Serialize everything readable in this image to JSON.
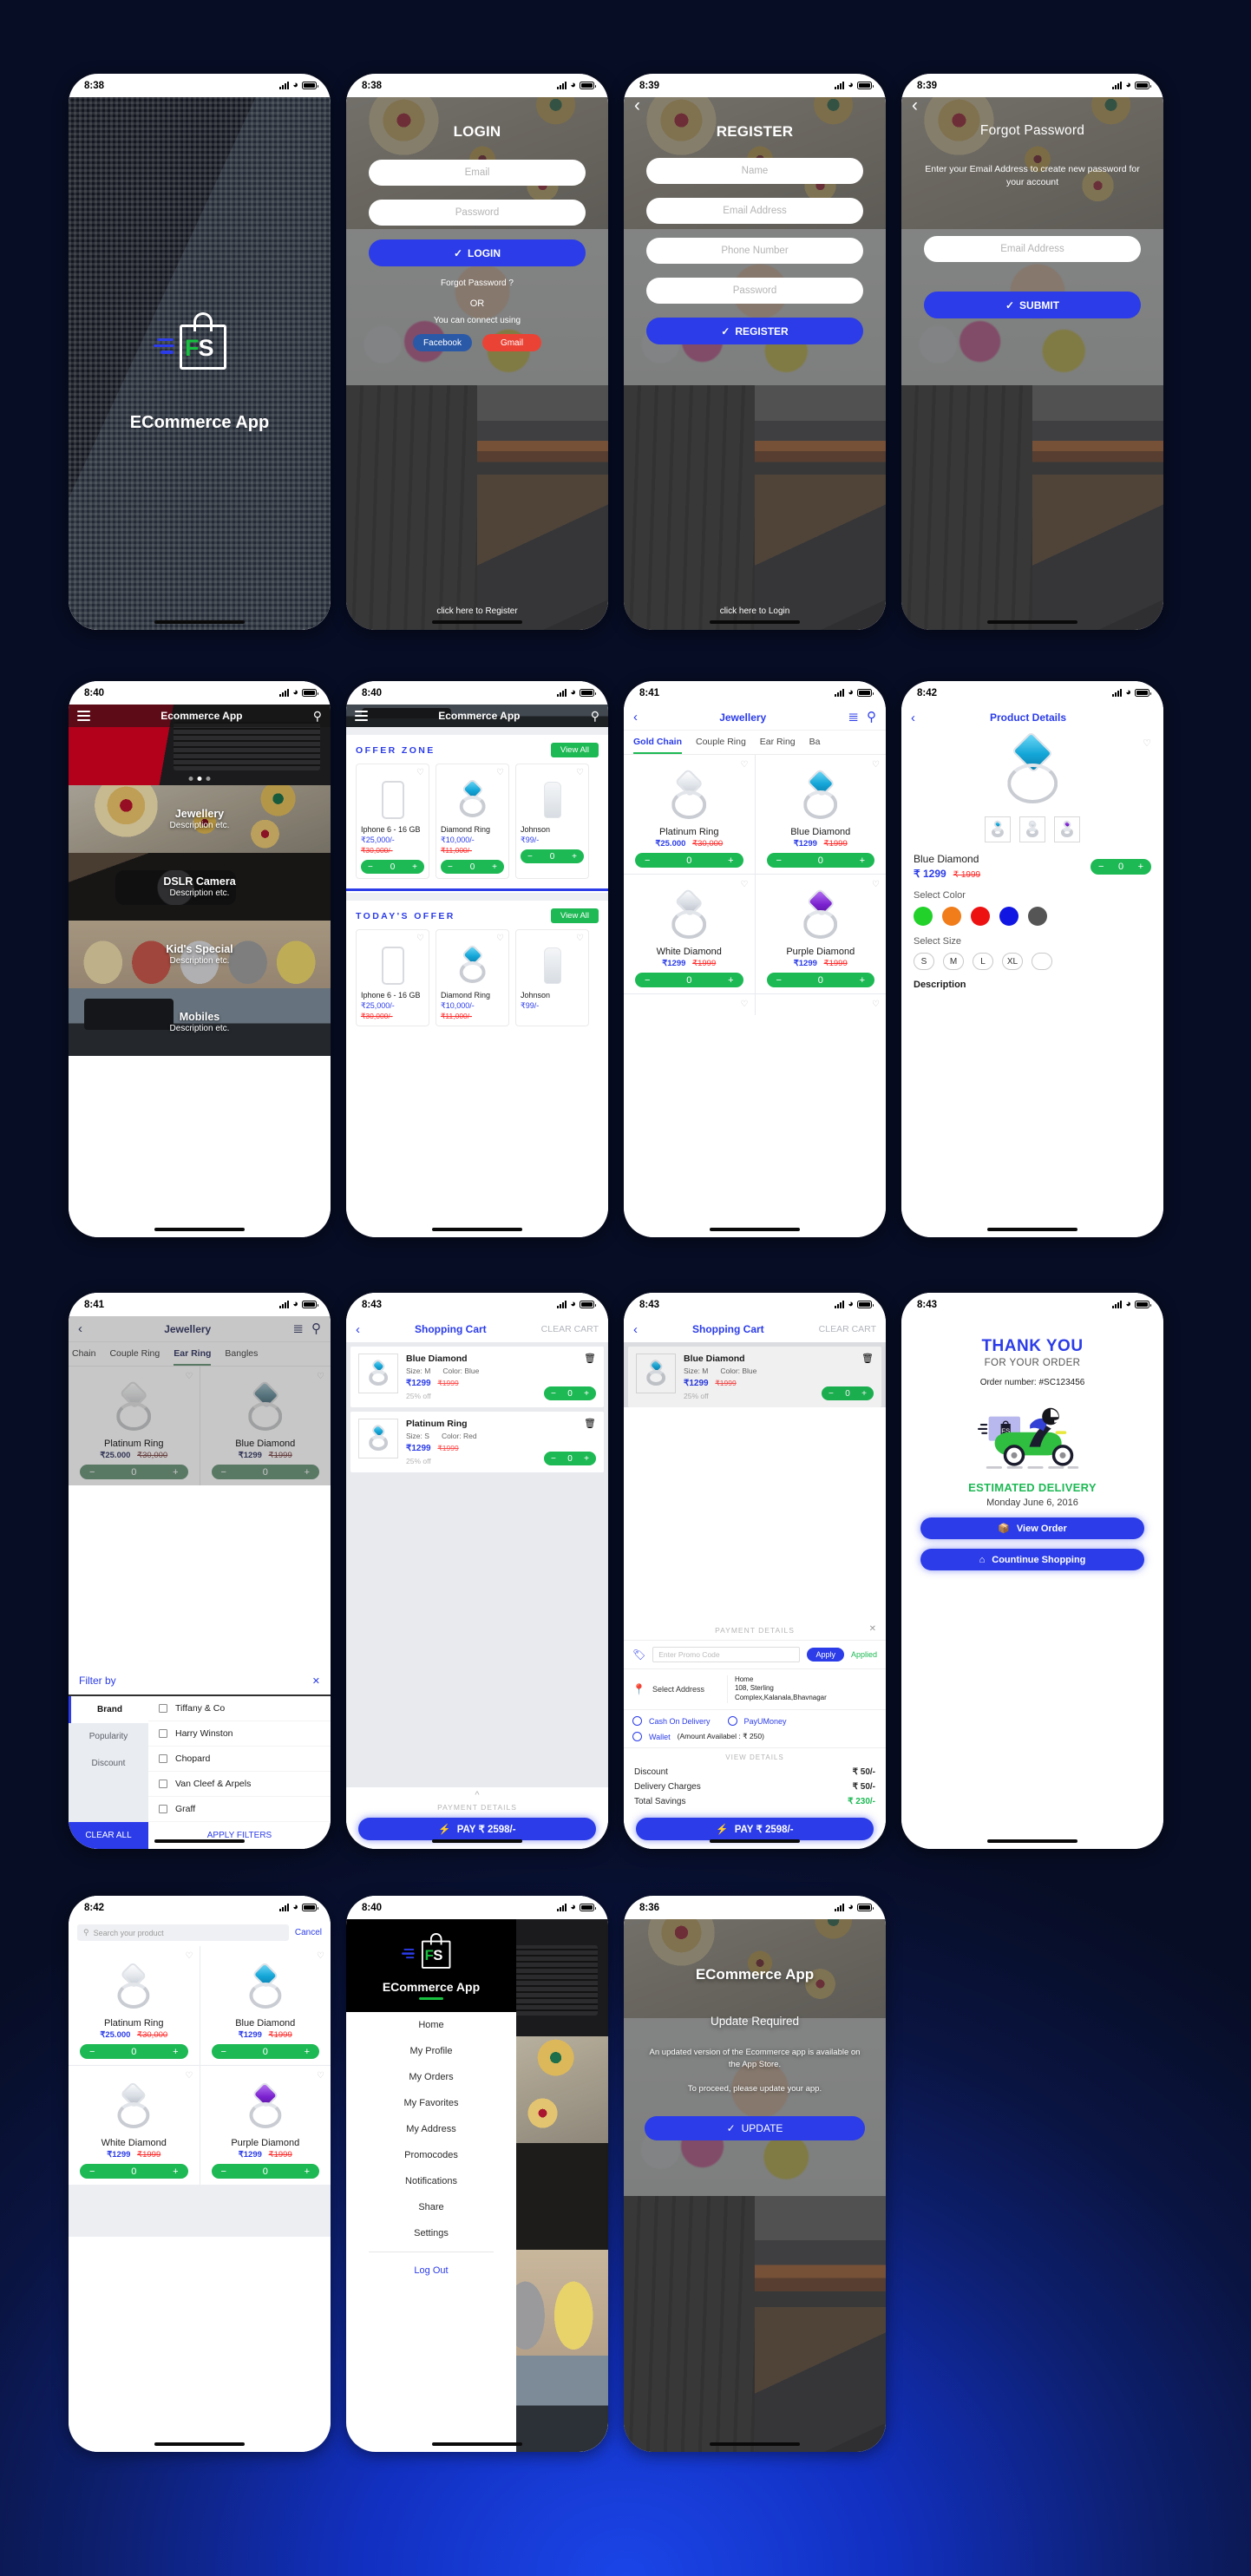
{
  "app": {
    "name": "ECommerce App",
    "brand_short": "FS"
  },
  "colors": {
    "primary": "#2b3ce8",
    "green": "#1db954",
    "red": "#ff2b2b",
    "facebook": "#2a59a8",
    "gmail": "#ea4335",
    "dark": "#000000"
  },
  "screens": {
    "splash": {
      "time": "8:38",
      "app_name": "ECommerce App"
    },
    "login": {
      "time": "8:38",
      "title": "LOGIN",
      "email_placeholder": "Email",
      "password_placeholder": "Password",
      "login_button": "LOGIN",
      "forgot": "Forgot Password ?",
      "or": "OR",
      "connect_using": "You can connect using",
      "facebook": "Facebook",
      "gmail": "Gmail",
      "register_link": "click here to Register"
    },
    "register": {
      "time": "8:39",
      "title": "REGISTER",
      "name_placeholder": "Name",
      "email_placeholder": "Email Address",
      "phone_placeholder": "Phone Number",
      "password_placeholder": "Password",
      "register_button": "REGISTER",
      "login_link": "click here to Login"
    },
    "forgot": {
      "time": "8:39",
      "title": "Forgot Password",
      "instruction": "Enter your Email Address to create new password for your account",
      "email_placeholder": "Email Address",
      "submit_button": "SUBMIT"
    },
    "home": {
      "time": "8:40",
      "appbar_title": "Ecommerce App",
      "categories": [
        {
          "name": "Jewellery",
          "desc": "Description etc."
        },
        {
          "name": "DSLR Camera",
          "desc": "Description etc."
        },
        {
          "name": "Kid's Special",
          "desc": "Description etc."
        },
        {
          "name": "Mobiles",
          "desc": "Description etc."
        }
      ]
    },
    "offers": {
      "time": "8:40",
      "appbar_title": "Ecommerce App",
      "sections": [
        {
          "title": "OFFER ZONE",
          "view_all": "View All",
          "products": [
            {
              "name": "Iphone 6 - 16 GB",
              "price": "₹25,000/-",
              "old": "₹30,000/-",
              "qty": "0",
              "art": "phone"
            },
            {
              "name": "Diamond Ring",
              "price": "₹10,000/-",
              "old": "₹11,000/-",
              "qty": "0",
              "art": "ring-blue"
            },
            {
              "name": "Johnson",
              "price": "₹99/-",
              "old": "",
              "qty": "0",
              "art": "bottle"
            }
          ]
        },
        {
          "title": "TODAY'S OFFER",
          "view_all": "View All",
          "products": [
            {
              "name": "Iphone 6 - 16 GB",
              "price": "₹25,000/-",
              "old": "₹30,000/-",
              "qty": "0",
              "art": "phone"
            },
            {
              "name": "Diamond Ring",
              "price": "₹10,000/-",
              "old": "₹11,000/-",
              "qty": "0",
              "art": "ring-blue"
            },
            {
              "name": "Johnson",
              "price": "₹99/-",
              "old": "",
              "qty": "0",
              "art": "bottle"
            }
          ]
        }
      ]
    },
    "listing": {
      "time": "8:41",
      "title": "Jewellery",
      "tabs": [
        "Gold Chain",
        "Couple Ring",
        "Ear Ring",
        "Ba"
      ],
      "active_tab": "Gold Chain",
      "products": [
        {
          "name": "Platinum Ring",
          "price": "₹25.000",
          "old": "₹30,000",
          "qty": "0",
          "art": "ring-clear"
        },
        {
          "name": "Blue Diamond",
          "price": "₹1299",
          "old": "₹1999",
          "qty": "0",
          "art": "ring-blue"
        },
        {
          "name": "White Diamond",
          "price": "₹1299",
          "old": "₹1999",
          "qty": "0",
          "art": "ring-white"
        },
        {
          "name": "Purple Diamond",
          "price": "₹1299",
          "old": "₹1999",
          "qty": "0",
          "art": "ring-purple"
        }
      ]
    },
    "details": {
      "time": "8:42",
      "title": "Product Details",
      "product_name": "Blue Diamond",
      "price": "₹ 1299",
      "old_price": "₹ 1999",
      "qty": "0",
      "select_color_label": "Select Color",
      "colors": [
        "#22d12a",
        "#f07c1a",
        "#ee1111",
        "#1116e2",
        "#555555"
      ],
      "select_size_label": "Select Size",
      "sizes": [
        "S",
        "M",
        "L",
        "XL"
      ],
      "description_label": "Description"
    },
    "filter": {
      "time": "8:41",
      "title": "Jewellery",
      "tabs": [
        "Chain",
        "Couple Ring",
        "Ear Ring",
        "Bangles"
      ],
      "active_tab": "Ear Ring",
      "products": [
        {
          "name": "Platinum Ring",
          "price": "₹25.000",
          "old": "₹30,000",
          "art": "ring-clear"
        },
        {
          "name": "Blue Diamond",
          "price": "₹1299",
          "old": "₹1999",
          "art": "ring-blue"
        }
      ],
      "sheet_title": "Filter by",
      "groups": [
        "Brand",
        "Popularity",
        "Discount"
      ],
      "active_group": "Brand",
      "brands": [
        "Tiffany & Co",
        "Harry Winston",
        "Chopard",
        "Van Cleef & Arpels",
        "Graff"
      ],
      "clear_all": "CLEAR ALL",
      "apply": "APPLY FILTERS"
    },
    "cart": {
      "time": "8:43",
      "title": "Shopping Cart",
      "clear_cart": "CLEAR CART",
      "items": [
        {
          "name": "Blue Diamond",
          "size": "Size: M",
          "color": "Color: Blue",
          "price": "₹1299",
          "old": "₹1999",
          "off": "25% off",
          "qty": "0"
        },
        {
          "name": "Platinum Ring",
          "size": "Size: S",
          "color": "Color: Red",
          "price": "₹1299",
          "old": "₹1999",
          "off": "25% off",
          "qty": "0"
        }
      ],
      "payment_details_label": "PAYMENT DETAILS",
      "pay_button": "PAY ₹ 2598/-"
    },
    "payment": {
      "time": "8:43",
      "title": "Shopping Cart",
      "clear_cart": "CLEAR CART",
      "sheet_title": "PAYMENT DETAILS",
      "promo_placeholder": "Enter Promo Code",
      "apply": "Apply",
      "applied": "Applied",
      "select_address_label": "Select Address",
      "address": "Home\n108, Sterling\nComplex,Kalanala,Bhavnagar",
      "address_lines": [
        "Home",
        "108, Sterling",
        "Complex,Kalanala,Bhavnagar"
      ],
      "pay_options": [
        "Cash On Delivery",
        "PayUMoney",
        "Wallet"
      ],
      "wallet_note": "(Amount Availabel : ₹ 250)",
      "view_details": "VIEW DETAILS",
      "summary": [
        {
          "label": "Discount",
          "value": "₹ 50/-",
          "green": false
        },
        {
          "label": "Delivery Charges",
          "value": "₹ 50/-",
          "green": false
        },
        {
          "label": "Total Savings",
          "value": "₹ 230/-",
          "green": true
        }
      ],
      "pay_button": "PAY ₹ 2598/-"
    },
    "thankyou": {
      "time": "8:43",
      "heading": "THANK YOU",
      "subheading": "FOR YOUR ORDER",
      "order_number": "Order number: #SC123456",
      "estimated_label": "ESTIMATED DELIVERY",
      "estimated_date": "Monday June 6, 2016",
      "view_order": "View Order",
      "continue_shopping": "Countinue Shopping"
    },
    "search": {
      "time": "8:42",
      "placeholder": "Search your product",
      "cancel": "Cancel",
      "products": [
        {
          "name": "Platinum Ring",
          "price": "₹25.000",
          "old": "₹30,000",
          "qty": "0",
          "art": "ring-clear"
        },
        {
          "name": "Blue Diamond",
          "price": "₹1299",
          "old": "₹1999",
          "qty": "0",
          "art": "ring-blue"
        },
        {
          "name": "White Diamond",
          "price": "₹1299",
          "old": "₹1999",
          "qty": "0",
          "art": "ring-white"
        },
        {
          "name": "Purple Diamond",
          "price": "₹1299",
          "old": "₹1999",
          "qty": "0",
          "art": "ring-purple"
        }
      ]
    },
    "drawer": {
      "time": "8:40",
      "app_name": "ECommerce App",
      "items": [
        "Home",
        "My Profile",
        "My Orders",
        "My Favorites",
        "My Address",
        "Promocodes",
        "Notifications",
        "Share",
        "Settings"
      ],
      "logout": "Log Out"
    },
    "update": {
      "time": "8:36",
      "app_name": "ECommerce App",
      "title": "Update Required",
      "line1": "An updated version of the Ecommerce app is available on the App Store.",
      "line2": "To proceed, please update your app.",
      "button": "UPDATE"
    }
  }
}
